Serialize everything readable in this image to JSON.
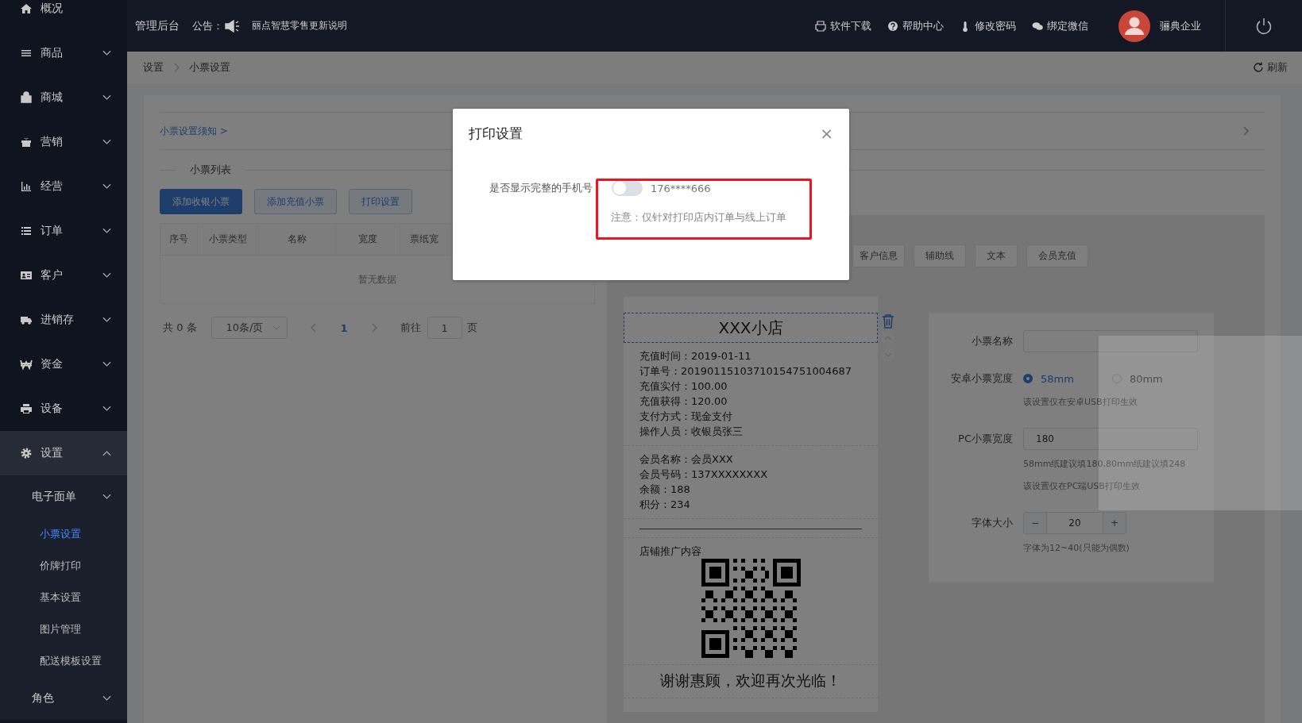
{
  "topbar": {
    "title": "管理后台",
    "notice_label": "公告：",
    "notice_text": "丽点智慧零售更新说明",
    "links": [
      "软件下载",
      "帮助中心",
      "修改密码",
      "绑定微信"
    ],
    "user": "骊典企业"
  },
  "sidebar": {
    "items": [
      {
        "label": "概况",
        "kind": "link"
      },
      {
        "label": "商品",
        "kind": "menu",
        "expanded": false
      },
      {
        "label": "商城",
        "kind": "menu",
        "expanded": false
      },
      {
        "label": "营销",
        "kind": "menu",
        "expanded": false
      },
      {
        "label": "经营",
        "kind": "menu",
        "expanded": false
      },
      {
        "label": "订单",
        "kind": "menu",
        "expanded": false
      },
      {
        "label": "客户",
        "kind": "menu",
        "expanded": false
      },
      {
        "label": "进销存",
        "kind": "menu",
        "expanded": false
      },
      {
        "label": "资金",
        "kind": "menu",
        "expanded": false
      },
      {
        "label": "设备",
        "kind": "menu",
        "expanded": false
      },
      {
        "label": "设置",
        "kind": "menu",
        "expanded": true,
        "children": [
          {
            "label": "电子面单",
            "kind": "group",
            "expanded": false
          },
          {
            "label": "小票设置",
            "kind": "link",
            "selected": true
          },
          {
            "label": "价牌打印",
            "kind": "link",
            "selected": false
          },
          {
            "label": "基本设置",
            "kind": "link",
            "selected": false
          },
          {
            "label": "图片管理",
            "kind": "link",
            "selected": false
          },
          {
            "label": "配送模板设置",
            "kind": "link",
            "selected": false
          },
          {
            "label": "角色",
            "kind": "group",
            "expanded": false
          }
        ]
      }
    ]
  },
  "breadcrumb": [
    "设置",
    "小票设置"
  ],
  "refresh": "刷新",
  "notice_link": "小票设置须知 >",
  "section_title": "小票列表",
  "buttons": [
    {
      "label": "添加收银小票",
      "kind": "primary"
    },
    {
      "label": "添加充值小票",
      "kind": "plain"
    },
    {
      "label": "打印设置",
      "kind": "plain"
    }
  ],
  "table": {
    "columns": [
      "序号",
      "小票类型",
      "名称",
      "宽度",
      "票纸宽"
    ],
    "empty_text": "暂无数据"
  },
  "pagination": {
    "total": "共 0 条",
    "page_size": "10条/页",
    "current": "1",
    "goto_label": "前往",
    "goto_value": "1",
    "page_unit": "页"
  },
  "editor": {
    "tools": [
      "客户信息",
      "辅助线",
      "文本",
      "会员充值"
    ],
    "receipt": {
      "title": "XXX小店",
      "sections": [
        {
          "kind": "lines",
          "lines": [
            "充值时间：2019-01-11",
            "订单号：20190115103710154751004687",
            "充值实付：100.00",
            "充值获得：120.00",
            "支付方式：现金支付",
            "操作人员：收银员张三"
          ]
        },
        {
          "kind": "lines",
          "lines": [
            "会员名称：会员XXX",
            "会员号码：137XXXXXXXX",
            "余额：188",
            "积分：234"
          ]
        },
        {
          "kind": "rule"
        },
        {
          "kind": "promo",
          "label": "店铺推广内容"
        },
        {
          "kind": "footer",
          "text": "谢谢惠顾，欢迎再次光临！"
        }
      ]
    },
    "form": {
      "name_label": "小票名称",
      "android": {
        "label": "安卓小票宽度",
        "options": [
          {
            "label": "58mm",
            "selected": true
          },
          {
            "label": "80mm",
            "selected": false
          }
        ],
        "hint": "该设置仅在安卓USB打印生效"
      },
      "pc": {
        "label": "PC小票宽度",
        "value": "180",
        "hints": [
          "58mm纸建议填180,80mm纸建议填248",
          "该设置仅在PC端USB打印生效"
        ]
      },
      "font": {
        "label": "字体大小",
        "value": "20",
        "minus": "−",
        "plus": "+",
        "hint": "字体为12~40(只能为偶数)"
      }
    }
  },
  "modal": {
    "title": "打印设置",
    "close": "×",
    "toggle": {
      "label": "是否显示完整的手机号",
      "on": false,
      "sample": "176****666"
    },
    "note": "注意：仅针对打印店内订单与线上订单"
  }
}
